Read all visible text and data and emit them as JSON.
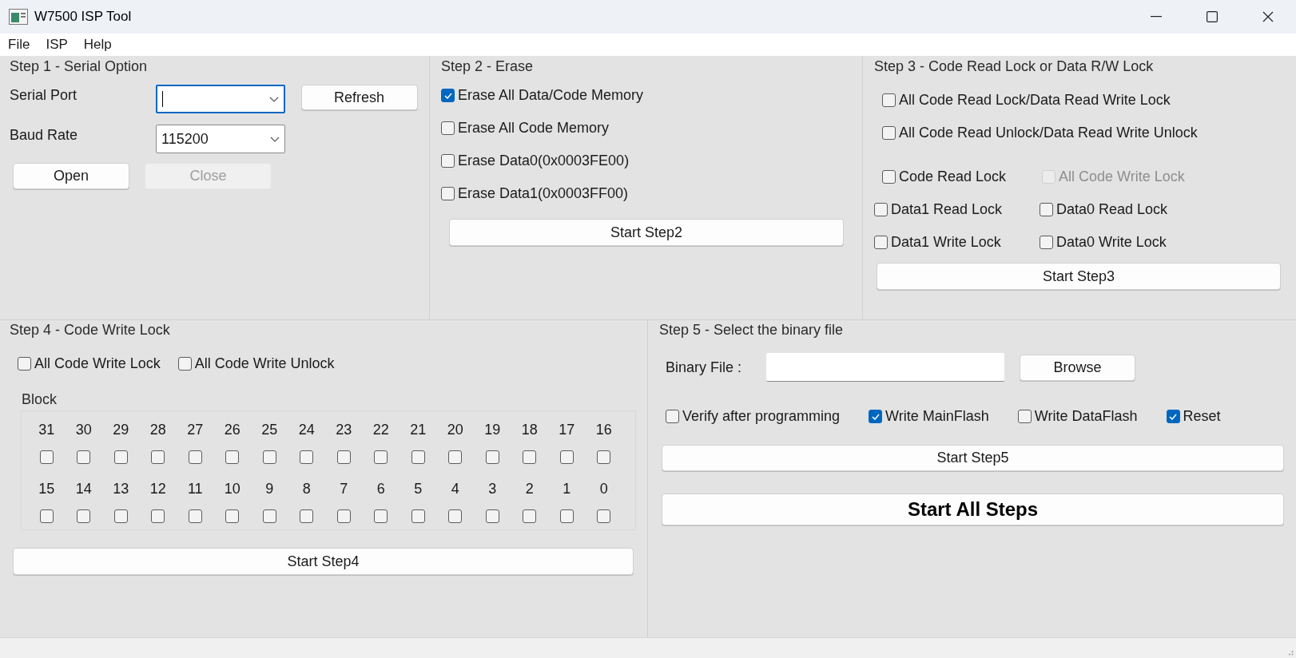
{
  "window": {
    "title": "W7500 ISP Tool"
  },
  "menu": [
    "File",
    "ISP",
    "Help"
  ],
  "step1": {
    "title": "Step 1 - Serial Option",
    "serial_port": {
      "label": "Serial Port",
      "focused": true
    },
    "baud_rate": {
      "label": "Baud Rate",
      "value": "115200"
    },
    "refresh": "Refresh",
    "open": {
      "label": "Open",
      "disabled": false
    },
    "close": {
      "label": "Close",
      "disabled": true
    }
  },
  "step2": {
    "title": "Step 2 - Erase",
    "options": [
      {
        "label": "Erase All Data/Code Memory",
        "checked": true
      },
      {
        "label": "Erase All Code Memory",
        "checked": false
      },
      {
        "label": "Erase Data0(0x0003FE00)",
        "checked": false
      },
      {
        "label": "Erase Data1(0x0003FF00)",
        "checked": false
      }
    ],
    "button": "Start Step2"
  },
  "step3": {
    "title": "Step 3 - Code Read Lock or Data R/W Lock",
    "rows": [
      [
        {
          "label": "All Code Read Lock/Data Read Write Lock",
          "checked": false,
          "disabled": false
        }
      ],
      [
        {
          "label": "All Code Read Unlock/Data Read Write Unlock",
          "checked": false,
          "disabled": false
        }
      ],
      [
        {
          "label": "Code Read Lock",
          "checked": false,
          "disabled": false
        },
        {
          "label": "All Code Write Lock",
          "checked": false,
          "disabled": true
        }
      ],
      [
        {
          "label": "Data1 Read Lock",
          "checked": false,
          "disabled": false
        },
        {
          "label": "Data0 Read Lock",
          "checked": false,
          "disabled": false
        }
      ],
      [
        {
          "label": "Data1 Write Lock",
          "checked": false,
          "disabled": false
        },
        {
          "label": "Data0 Write Lock",
          "checked": false,
          "disabled": false
        }
      ]
    ],
    "button": "Start Step3"
  },
  "step4": {
    "title": "Step 4 - Code Write Lock",
    "options": [
      {
        "label": "All Code Write Lock",
        "checked": false
      },
      {
        "label": "All Code Write Unlock",
        "checked": false
      }
    ],
    "block_title": "Block",
    "block_rows": [
      [
        {
          "label": "31",
          "checked": false
        },
        {
          "label": "30",
          "checked": false
        },
        {
          "label": "29",
          "checked": false
        },
        {
          "label": "28",
          "checked": false
        },
        {
          "label": "27",
          "checked": false
        },
        {
          "label": "26",
          "checked": false
        },
        {
          "label": "25",
          "checked": false
        },
        {
          "label": "24",
          "checked": false
        },
        {
          "label": "23",
          "checked": false
        },
        {
          "label": "22",
          "checked": false
        },
        {
          "label": "21",
          "checked": false
        },
        {
          "label": "20",
          "checked": false
        },
        {
          "label": "19",
          "checked": false
        },
        {
          "label": "18",
          "checked": false
        },
        {
          "label": "17",
          "checked": false
        },
        {
          "label": "16",
          "checked": false
        }
      ],
      [
        {
          "label": "15",
          "checked": false
        },
        {
          "label": "14",
          "checked": false
        },
        {
          "label": "13",
          "checked": false
        },
        {
          "label": "12",
          "checked": false
        },
        {
          "label": "11",
          "checked": false
        },
        {
          "label": "10",
          "checked": false
        },
        {
          "label": "9",
          "checked": false
        },
        {
          "label": "8",
          "checked": false
        },
        {
          "label": "7",
          "checked": false
        },
        {
          "label": "6",
          "checked": false
        },
        {
          "label": "5",
          "checked": false
        },
        {
          "label": "4",
          "checked": false
        },
        {
          "label": "3",
          "checked": false
        },
        {
          "label": "2",
          "checked": false
        },
        {
          "label": "1",
          "checked": false
        },
        {
          "label": "0",
          "checked": false
        }
      ]
    ],
    "button": "Start Step4"
  },
  "step5": {
    "title": "Step 5 - Select the binary file",
    "binary_file": {
      "label": "Binary File :"
    },
    "browse": "Browse",
    "options": [
      {
        "label": "Verify after programming",
        "checked": false
      },
      {
        "label": "Write MainFlash",
        "checked": true
      },
      {
        "label": "Write DataFlash",
        "checked": false
      },
      {
        "label": "Reset",
        "checked": true
      }
    ],
    "button": "Start Step5",
    "start_all": "Start All Steps"
  }
}
